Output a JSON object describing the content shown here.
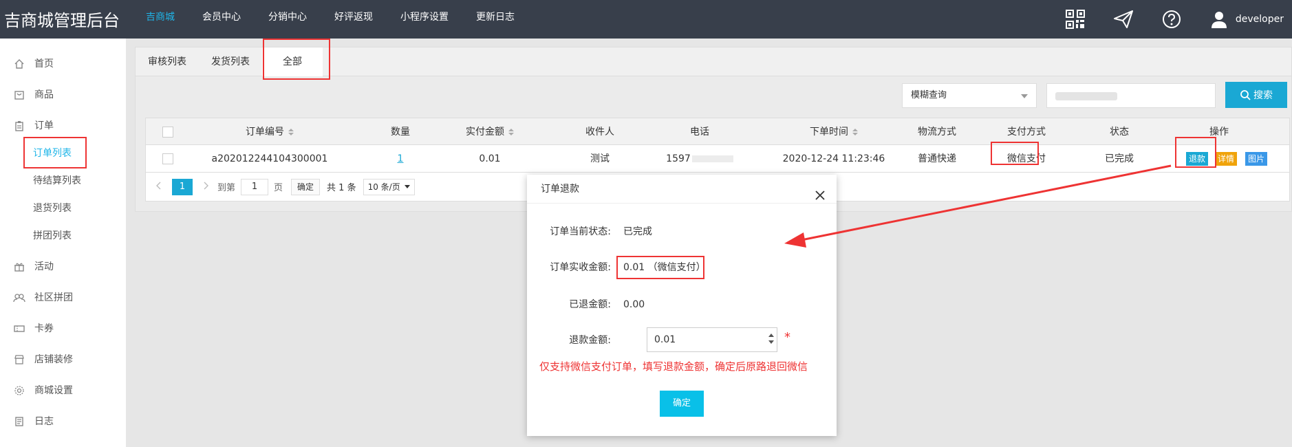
{
  "app": {
    "title": "吉商城管理后台"
  },
  "topnav": [
    {
      "label": "吉商城",
      "active": true
    },
    {
      "label": "会员中心",
      "active": false
    },
    {
      "label": "分销中心",
      "active": false
    },
    {
      "label": "好评返现",
      "active": false
    },
    {
      "label": "小程序设置",
      "active": false
    },
    {
      "label": "更新日志",
      "active": false
    }
  ],
  "user": {
    "name": "developer"
  },
  "sidebar": {
    "home": "首页",
    "goods": "商品",
    "orders": "订单",
    "order_subitems": [
      {
        "label": "订单列表",
        "active": true
      },
      {
        "label": "待结算列表",
        "active": false
      },
      {
        "label": "退货列表",
        "active": false
      },
      {
        "label": "拼团列表",
        "active": false
      }
    ],
    "activity": "活动",
    "community": "社区拼团",
    "coupons": "卡券",
    "decor": "店铺装修",
    "settings": "商城设置",
    "log": "日志"
  },
  "tabs": [
    {
      "label": "审核列表",
      "active": false
    },
    {
      "label": "发货列表",
      "active": false
    },
    {
      "label": "全部",
      "active": true
    }
  ],
  "filter": {
    "select_value": "模糊查询",
    "search_button": "搜索"
  },
  "table": {
    "headers": {
      "order_no": "订单编号",
      "qty": "数量",
      "paid": "实付金额",
      "receiver": "收件人",
      "phone": "电话",
      "time": "下单时间",
      "shipping": "物流方式",
      "payment": "支付方式",
      "status": "状态",
      "ops": "操作"
    },
    "rows": [
      {
        "order_no": "a202012244104300001",
        "qty": "1",
        "paid": "0.01",
        "receiver": "测试",
        "phone": "1597",
        "time": "2020-12-24 11:23:46",
        "shipping": "普通快递",
        "payment": "微信支付",
        "status": "已完成",
        "op_refund": "退款",
        "op_detail": "详情",
        "op_image": "图片"
      }
    ]
  },
  "pager": {
    "current": "1",
    "goto_label": "到第",
    "goto_value": "1",
    "page_suffix": "页",
    "confirm": "确定",
    "total": "共 1 条",
    "page_size": "10 条/页"
  },
  "dialog": {
    "title": "订单退款",
    "status_label": "订单当前状态:",
    "status_value": "已完成",
    "paid_label": "订单实收金额:",
    "paid_value": "0.01 （微信支付）",
    "refunded_label": "已退金额:",
    "refunded_value": "0.00",
    "refund_label": "退款金额:",
    "refund_value": "0.01",
    "required_mark": "*",
    "hint": "仅支持微信支付订单，填写退款金额，确定后原路退回微信",
    "ok": "确定"
  },
  "colors": {
    "topbar": "#383f4b",
    "accent": "#1aa8d4",
    "annotation": "#e33333",
    "detail_button": "#f0a30a"
  }
}
